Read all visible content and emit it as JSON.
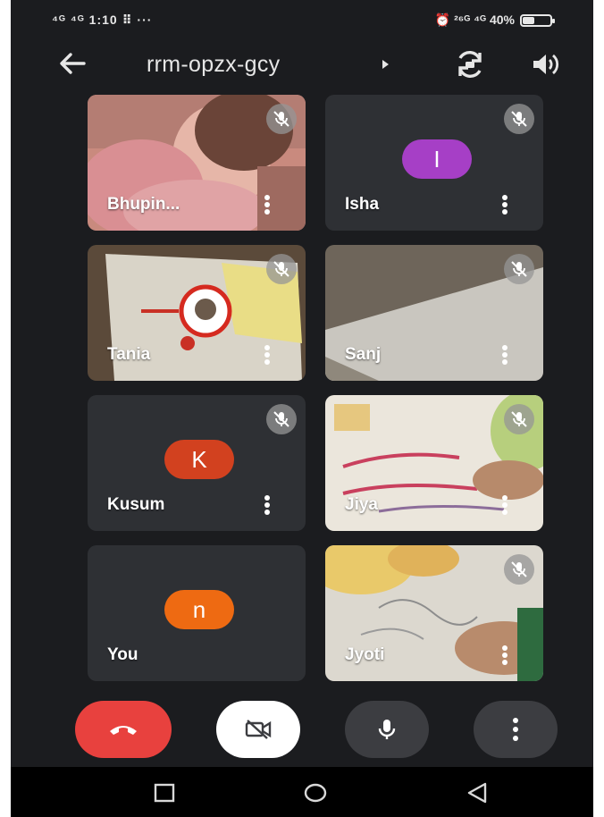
{
  "status_bar": {
    "left": "⁴ᴳ ⁴ᴳ 1:10 ⠿ ···",
    "right": "⏰ ²⁶ᴳ ⁴ᴳ 40%",
    "battery_level": 0.4
  },
  "header": {
    "meeting_code": "rrm-opzx-gcy"
  },
  "participants": [
    {
      "name": "Bhupin...",
      "initial": ""
    },
    {
      "name": "Isha",
      "initial": "I",
      "avatar_color": "#a63fc6"
    },
    {
      "name": "Tania",
      "initial": ""
    },
    {
      "name": "Sanj",
      "initial": ""
    },
    {
      "name": "Kusum",
      "initial": "K",
      "avatar_color": "#d2411f"
    },
    {
      "name": "Jiya",
      "initial": ""
    },
    {
      "name": "You",
      "initial": "n",
      "avatar_color": "#ee6a12"
    },
    {
      "name": "Jyoti",
      "initial": ""
    }
  ],
  "controls": {
    "end_call_color": "#e8413e",
    "camera_button_color": "#ffffff",
    "secondary_button_color": "#3c3d41"
  },
  "icons": [
    "back-arrow-icon",
    "caret-right-icon",
    "switch-camera-icon",
    "speaker-icon",
    "mic-off-icon",
    "more-vert-icon",
    "end-call-icon",
    "camera-off-icon",
    "mic-icon",
    "nav-square-icon",
    "nav-circle-icon",
    "nav-triangle-icon"
  ]
}
